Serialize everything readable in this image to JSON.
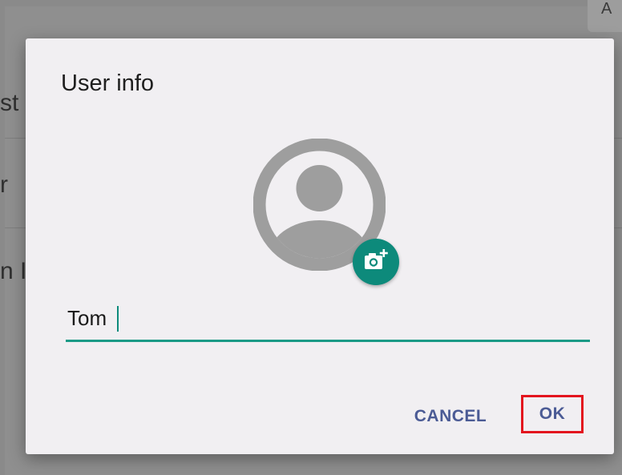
{
  "background": {
    "top_chip_text": "A",
    "row_texts": [
      "st",
      "r",
      "n I"
    ]
  },
  "dialog": {
    "title": "User info",
    "name_value": "Tom",
    "cancel_label": "CANCEL",
    "ok_label": "OK"
  },
  "icons": {
    "avatar": "account-circle-icon",
    "camera": "add-a-photo-icon"
  },
  "colors": {
    "accent": "#0d8a7b",
    "button_text": "#4b5b95",
    "highlight": "#e3141e",
    "dialog_bg": "#f1eff2"
  }
}
